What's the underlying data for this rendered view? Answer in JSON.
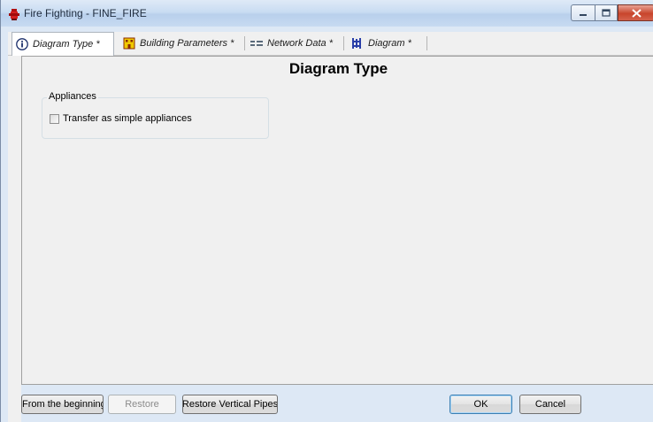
{
  "window": {
    "title": "Fire Fighting - FINE_FIRE",
    "controls": [
      "minimize-icon",
      "maximize-icon",
      "close-icon"
    ]
  },
  "tabs": [
    {
      "label": "Diagram Type *",
      "icon": "info-icon",
      "active": true
    },
    {
      "label": "Building Parameters *",
      "icon": "building-icon",
      "active": false
    },
    {
      "label": "Network Data *",
      "icon": "network-icon",
      "active": false
    },
    {
      "label": "Diagram *",
      "icon": "diagram-icon",
      "active": false
    }
  ],
  "panel": {
    "title": "Diagram Type",
    "group": {
      "legend": "Appliances",
      "checkbox_label": "Transfer as simple appliances",
      "checked": false
    }
  },
  "buttons": {
    "from_beginning": "From the beginning",
    "restore": "Restore",
    "restore_vertical_pipes": "Restore Vertical Pipes",
    "ok": "OK",
    "cancel": "Cancel"
  },
  "colors": {
    "close_button": "#c8452c",
    "title_bar": "#c9dcf2",
    "panel_bg": "#f0f0f0"
  }
}
